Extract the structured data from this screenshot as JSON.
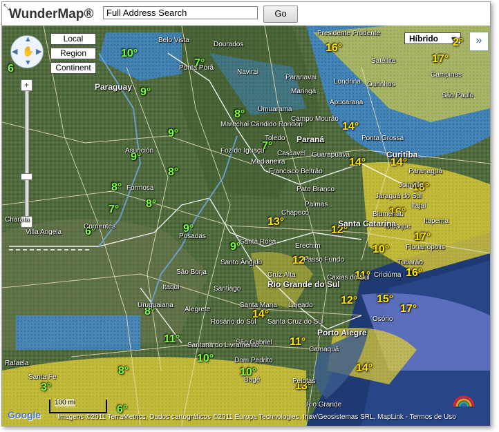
{
  "app": {
    "title": "WunderMap®",
    "resize_glyph": "⤡"
  },
  "search": {
    "value": "Full Address Search",
    "button": "Go"
  },
  "controls": {
    "local": "Local",
    "region": "Region",
    "continent": "Continent",
    "zoom_in": "+",
    "zoom_out": "−",
    "map_type": "Híbrido",
    "expand": "»"
  },
  "colors": {
    "green_temp": "#7dff3a",
    "yellow_temp": "#ffe300",
    "radar_blue": "#3e8de0",
    "radar_yellow": "#e6d23a"
  },
  "temps": [
    {
      "v": "10°",
      "c": "g"
    },
    {
      "v": "7°",
      "c": "g"
    },
    {
      "v": "6",
      "c": "g"
    },
    {
      "v": "9°",
      "c": "g"
    },
    {
      "v": "8°",
      "c": "g"
    },
    {
      "v": "9°",
      "c": "g"
    },
    {
      "v": "7°",
      "c": "g"
    },
    {
      "v": "9°",
      "c": "g"
    },
    {
      "v": "8°",
      "c": "g"
    },
    {
      "v": "8°",
      "c": "g"
    },
    {
      "v": "8°",
      "c": "g"
    },
    {
      "v": "7°",
      "c": "g"
    },
    {
      "v": "6°",
      "c": "g"
    },
    {
      "v": "9°",
      "c": "g"
    },
    {
      "v": "9°",
      "c": "g"
    },
    {
      "v": "8°",
      "c": "g"
    },
    {
      "v": "11°",
      "c": "g"
    },
    {
      "v": "10°",
      "c": "g"
    },
    {
      "v": "8°",
      "c": "g"
    },
    {
      "v": "10°",
      "c": "g"
    },
    {
      "v": "3°",
      "c": "g"
    },
    {
      "v": "6°",
      "c": "g"
    },
    {
      "v": "16°",
      "c": "y"
    },
    {
      "v": "14°",
      "c": "y"
    },
    {
      "v": "14°",
      "c": "y"
    },
    {
      "v": "14°",
      "c": "y"
    },
    {
      "v": "18°",
      "c": "y"
    },
    {
      "v": "16°",
      "c": "y"
    },
    {
      "v": "13°",
      "c": "y"
    },
    {
      "v": "12°",
      "c": "y"
    },
    {
      "v": "17°",
      "c": "y"
    },
    {
      "v": "10°",
      "c": "y"
    },
    {
      "v": "12°",
      "c": "y"
    },
    {
      "v": "11°",
      "c": "y"
    },
    {
      "v": "16°",
      "c": "y"
    },
    {
      "v": "12°",
      "c": "y"
    },
    {
      "v": "15°",
      "c": "y"
    },
    {
      "v": "17°",
      "c": "y"
    },
    {
      "v": "14°",
      "c": "y"
    },
    {
      "v": "11°",
      "c": "y"
    },
    {
      "v": "14°",
      "c": "y"
    },
    {
      "v": "13°",
      "c": "y"
    },
    {
      "v": "17°",
      "c": "y"
    },
    {
      "v": "2°",
      "c": "y"
    }
  ],
  "places": [
    "Belo Vista",
    "Dourados",
    "Ponta Porã",
    "Navirai",
    "Presidente Prudente",
    "Paranavai",
    "Maringá",
    "Londrina",
    "Apucarana",
    "Ourinhos",
    "Campinas",
    "São Paulo",
    "Satéllite",
    "Paraguay",
    "Umuarama",
    "Campo Mourão",
    "Marechal Cândido Rondon",
    "Toledo",
    "Cascavel",
    "Paraná",
    "Guarapuava",
    "Ponta Grossa",
    "Curitiba",
    "Paranaguá",
    "Joinville",
    "Jaraguá do Sul",
    "Itajaí",
    "Blumenau",
    "Brusque",
    "Itapema",
    "Florianópolis",
    "Foz do Iguaçu",
    "Medianeira",
    "Francisco Beltrão",
    "Pato Branco",
    "Palmas",
    "Chapecó",
    "Santa Catarina",
    "Erechim",
    "Passo Fundo",
    "Caxias do Sul",
    "Rio Grande do Sul",
    "Porto Alegre",
    "Osório",
    "Tubarão",
    "Criciúma",
    "Asunción",
    "Formosa",
    "Corrientes",
    "Posadas",
    "Villa Angela",
    "Santa Rosa",
    "Santo Ângelo",
    "Ijuí",
    "Cruz Alta",
    "São Borja",
    "Santiago",
    "Itaqui",
    "Uruguaiana",
    "Alegrete",
    "Santa Maria",
    "Lajeado",
    "Rosário do Sul",
    "São Gabriel",
    "Santana do Livramento",
    "Santa Cruz do Sul",
    "Camaquã",
    "Dom Pedrito",
    "Bagé",
    "Pelotas",
    "Rio Grande",
    "Rafaela",
    "Santa Fe",
    "Charata",
    "Caçapava",
    "Gramado",
    "Chapecó"
  ],
  "scale": {
    "label": "100 mi"
  },
  "attribution": "Imagens ©2011 TerraMetrics, Dados cartográficos ©2011 Europa Technologies, Inav/Geosistemas SRL, MapLink - Termos de Uso",
  "google": "Google"
}
